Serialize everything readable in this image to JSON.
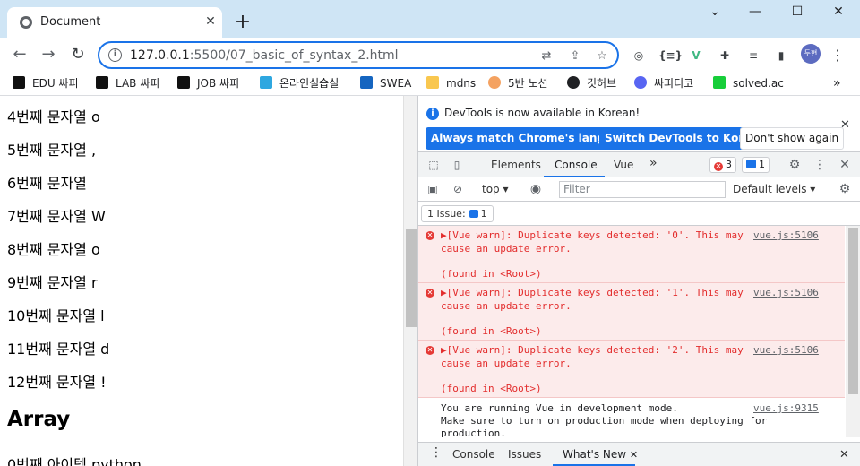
{
  "browser": {
    "tab_title": "Document",
    "tab_close": "✕",
    "new_tab": "+",
    "window_controls": [
      "⌄",
      "—",
      "☐",
      "✕"
    ],
    "url_host": "127.0.0.1",
    "url_path": ":5500/07_basic_of_syntax_2.html",
    "avatar_text": "두현",
    "bookmarks": [
      {
        "label": "EDU 싸피",
        "color": "#111111"
      },
      {
        "label": "LAB 싸피",
        "color": "#111111"
      },
      {
        "label": "JOB 싸피",
        "color": "#111111"
      },
      {
        "label": "온라인실습실",
        "color": "#2ea7e0"
      },
      {
        "label": "SWEA",
        "color": "#1565c0"
      },
      {
        "label": "mdns",
        "color": "#f9c74f"
      },
      {
        "label": "5반 노션",
        "color": "#f4a261"
      },
      {
        "label": "깃허브",
        "color": "#202124"
      },
      {
        "label": "싸피디코",
        "color": "#5865f2"
      },
      {
        "label": "solved.ac",
        "color": "#17ce3a"
      }
    ],
    "bookmarks_more": "»"
  },
  "page": {
    "lines": [
      "4번째 문자열 o",
      "5번째 문자열 ,",
      "6번째 문자열",
      "7번째 문자열 W",
      "8번째 문자열 o",
      "9번째 문자열 r",
      "10번째 문자열 l",
      "11번째 문자열 d",
      "12번째 문자열 !"
    ],
    "heading": "Array",
    "array_line": "0번째 아이템 python"
  },
  "devtools": {
    "banner_text": "DevTools is now available in Korean!",
    "btn_match": "Always match Chrome's language",
    "btn_switch": "Switch DevTools to Korean",
    "btn_dont": "Don't show again",
    "tabs": [
      "Elements",
      "Console",
      "Vue"
    ],
    "more_tabs": "»",
    "error_count": "3",
    "issue_count": "1",
    "context": "top",
    "filter_placeholder": "Filter",
    "levels": "Default levels",
    "issues_label": "1 Issue:",
    "issues_count": "1",
    "errors": [
      {
        "line1": "▶[Vue warn]: Duplicate keys detected: '0'. This may",
        "line2": "cause an update error.",
        "line3": "(found in <Root>)",
        "src": "vue.js:5106"
      },
      {
        "line1": "▶[Vue warn]: Duplicate keys detected: '1'. This may",
        "line2": "cause an update error.",
        "line3": "(found in <Root>)",
        "src": "vue.js:5106"
      },
      {
        "line1": "▶[Vue warn]: Duplicate keys detected: '2'. This may",
        "line2": "cause an update error.",
        "line3": "(found in <Root>)",
        "src": "vue.js:5106"
      }
    ],
    "info": {
      "line1": "You are running Vue in development mode.",
      "line2": "Make sure to turn on production mode when deploying for",
      "line3": "production.",
      "src": "vue.js:9315"
    },
    "drawer_tabs": [
      "Console",
      "Issues",
      "What's New"
    ],
    "drawer_close": "✕"
  }
}
